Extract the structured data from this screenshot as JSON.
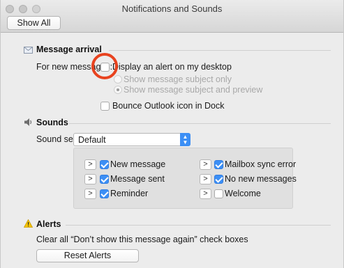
{
  "window": {
    "title": "Notifications and Sounds",
    "show_all_label": "Show All"
  },
  "message_arrival": {
    "heading": "Message arrival",
    "for_new_label": "For new messages:",
    "display_alert_label": "Display an alert on my desktop",
    "display_alert_checked": false,
    "radio_subject_only": "Show message subject only",
    "radio_subject_preview": "Show message subject and preview",
    "radio_selected": "subject_preview",
    "bounce_label": "Bounce Outlook icon in Dock",
    "bounce_checked": false
  },
  "sounds": {
    "heading": "Sounds",
    "sound_set_label": "Sound set:",
    "sound_set_value": "Default",
    "items": [
      {
        "label": "New message",
        "checked": true
      },
      {
        "label": "Message sent",
        "checked": true
      },
      {
        "label": "Reminder",
        "checked": true
      },
      {
        "label": "Mailbox sync error",
        "checked": true
      },
      {
        "label": "No new messages",
        "checked": true
      },
      {
        "label": "Welcome",
        "checked": false
      }
    ]
  },
  "alerts": {
    "heading": "Alerts",
    "description": "Clear all “Don’t show this message again” check boxes",
    "reset_label": "Reset Alerts"
  },
  "colors": {
    "accent": "#3c8ff5",
    "annotation": "#e8431f"
  }
}
